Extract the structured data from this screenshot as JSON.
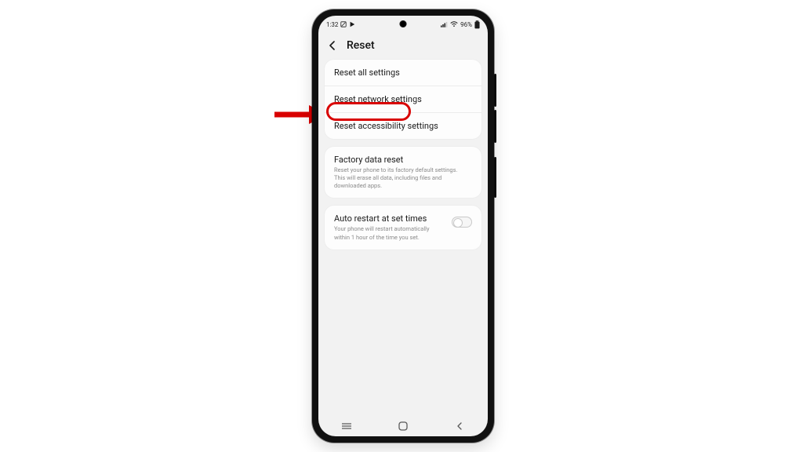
{
  "statusbar": {
    "time": "1:32",
    "battery_pct": "96%"
  },
  "header": {
    "title": "Reset"
  },
  "group1": {
    "items": [
      {
        "label": "Reset all settings"
      },
      {
        "label": "Reset network settings"
      },
      {
        "label": "Reset accessibility settings"
      }
    ]
  },
  "group2": {
    "label": "Factory data reset",
    "sub": "Reset your phone to its factory default settings. This will erase all data, including files and downloaded apps."
  },
  "group3": {
    "label": "Auto restart at set times",
    "sub": "Your phone will restart automatically within 1 hour of the time you set."
  },
  "annotation": {
    "target": "Reset network settings"
  }
}
